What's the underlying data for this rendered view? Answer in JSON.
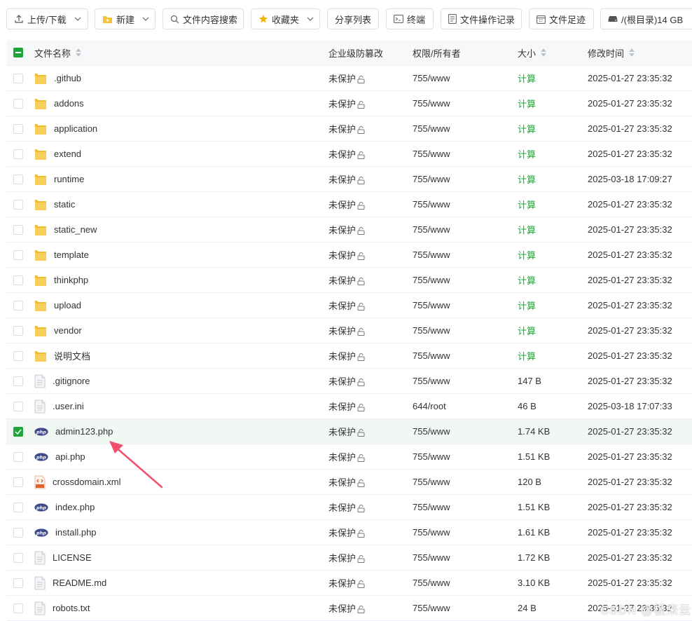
{
  "toolbar": {
    "upload": "上传/下载",
    "new": "新建",
    "content_search": "文件内容搜索",
    "favorites": "收藏夹",
    "share_list": "分享列表",
    "terminal": "终端",
    "file_log": "文件操作记录",
    "footprint": "文件足迹",
    "disk": "/(根目录)14 GB"
  },
  "table": {
    "headers": {
      "name": "文件名称",
      "protect": "企业级防篡改",
      "perm": "权限/所有者",
      "size": "大小",
      "mtime": "修改时间"
    },
    "rows": [
      {
        "name": ".github",
        "icon": "folder",
        "protect": "未保护",
        "perm": "755/www",
        "size": "计算",
        "mtime": "2025-01-27 23:35:32",
        "checked": false
      },
      {
        "name": "addons",
        "icon": "folder",
        "protect": "未保护",
        "perm": "755/www",
        "size": "计算",
        "mtime": "2025-01-27 23:35:32",
        "checked": false
      },
      {
        "name": "application",
        "icon": "folder",
        "protect": "未保护",
        "perm": "755/www",
        "size": "计算",
        "mtime": "2025-01-27 23:35:32",
        "checked": false
      },
      {
        "name": "extend",
        "icon": "folder",
        "protect": "未保护",
        "perm": "755/www",
        "size": "计算",
        "mtime": "2025-01-27 23:35:32",
        "checked": false
      },
      {
        "name": "runtime",
        "icon": "folder",
        "protect": "未保护",
        "perm": "755/www",
        "size": "计算",
        "mtime": "2025-03-18 17:09:27",
        "checked": false
      },
      {
        "name": "static",
        "icon": "folder",
        "protect": "未保护",
        "perm": "755/www",
        "size": "计算",
        "mtime": "2025-01-27 23:35:32",
        "checked": false
      },
      {
        "name": "static_new",
        "icon": "folder",
        "protect": "未保护",
        "perm": "755/www",
        "size": "计算",
        "mtime": "2025-01-27 23:35:32",
        "checked": false
      },
      {
        "name": "template",
        "icon": "folder",
        "protect": "未保护",
        "perm": "755/www",
        "size": "计算",
        "mtime": "2025-01-27 23:35:32",
        "checked": false
      },
      {
        "name": "thinkphp",
        "icon": "folder",
        "protect": "未保护",
        "perm": "755/www",
        "size": "计算",
        "mtime": "2025-01-27 23:35:32",
        "checked": false
      },
      {
        "name": "upload",
        "icon": "folder",
        "protect": "未保护",
        "perm": "755/www",
        "size": "计算",
        "mtime": "2025-01-27 23:35:32",
        "checked": false
      },
      {
        "name": "vendor",
        "icon": "folder",
        "protect": "未保护",
        "perm": "755/www",
        "size": "计算",
        "mtime": "2025-01-27 23:35:32",
        "checked": false
      },
      {
        "name": "说明文档",
        "icon": "folder",
        "protect": "未保护",
        "perm": "755/www",
        "size": "计算",
        "mtime": "2025-01-27 23:35:32",
        "checked": false
      },
      {
        "name": ".gitignore",
        "icon": "file",
        "protect": "未保护",
        "perm": "755/www",
        "size": "147 B",
        "mtime": "2025-01-27 23:35:32",
        "checked": false
      },
      {
        "name": ".user.ini",
        "icon": "file",
        "protect": "未保护",
        "perm": "644/root",
        "size": "46 B",
        "mtime": "2025-03-18 17:07:33",
        "checked": false
      },
      {
        "name": "admin123.php",
        "icon": "php",
        "protect": "未保护",
        "perm": "755/www",
        "size": "1.74 KB",
        "mtime": "2025-01-27 23:35:32",
        "checked": true
      },
      {
        "name": "api.php",
        "icon": "php",
        "protect": "未保护",
        "perm": "755/www",
        "size": "1.51 KB",
        "mtime": "2025-01-27 23:35:32",
        "checked": false
      },
      {
        "name": "crossdomain.xml",
        "icon": "xml",
        "protect": "未保护",
        "perm": "755/www",
        "size": "120 B",
        "mtime": "2025-01-27 23:35:32",
        "checked": false
      },
      {
        "name": "index.php",
        "icon": "php",
        "protect": "未保护",
        "perm": "755/www",
        "size": "1.51 KB",
        "mtime": "2025-01-27 23:35:32",
        "checked": false
      },
      {
        "name": "install.php",
        "icon": "php",
        "protect": "未保护",
        "perm": "755/www",
        "size": "1.61 KB",
        "mtime": "2025-01-27 23:35:32",
        "checked": false
      },
      {
        "name": "LICENSE",
        "icon": "file",
        "protect": "未保护",
        "perm": "755/www",
        "size": "1.72 KB",
        "mtime": "2025-01-27 23:35:32",
        "checked": false
      },
      {
        "name": "README.md",
        "icon": "file",
        "protect": "未保护",
        "perm": "755/www",
        "size": "3.10 KB",
        "mtime": "2025-01-27 23:35:32",
        "checked": false
      },
      {
        "name": "robots.txt",
        "icon": "file",
        "protect": "未保护",
        "perm": "755/www",
        "size": "24 B",
        "mtime": "2025-01-27 23:35:32",
        "checked": false
      }
    ]
  },
  "watermark": "CSDN @极来云",
  "colors": {
    "accent": "#20a53a",
    "folder": "#f5c33b",
    "php": "#3f4a8c",
    "arrow": "#f0506e"
  }
}
